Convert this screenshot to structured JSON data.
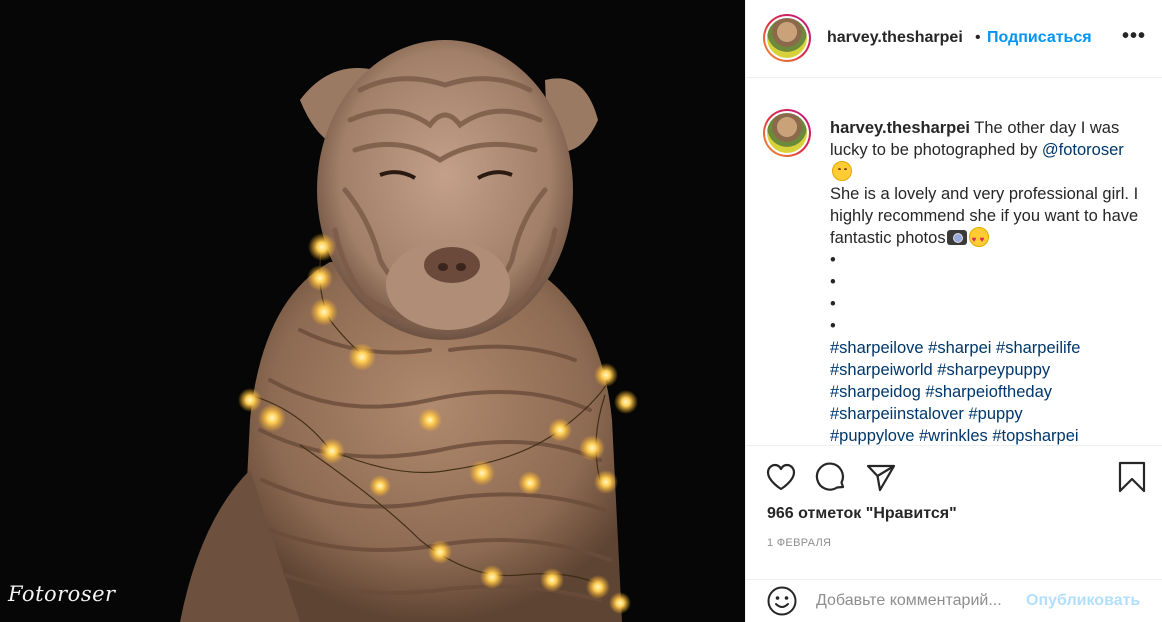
{
  "photo": {
    "watermark": "Fotoroser",
    "alt": "Shar pei dog with fairy lights"
  },
  "header": {
    "username": "harvey.thesharpei",
    "separator": "•",
    "follow_label": "Подписаться",
    "more_label": "•••"
  },
  "caption": {
    "username": "harvey.thesharpei",
    "text_1": " The other day I was lucky to be photographed by ",
    "mention": "@fotoroser",
    "text_2": "She is a lovely and very professional girl. I highly recommend she if you want to have fantastic photos",
    "bullets": [
      "•",
      "•",
      "•",
      "•"
    ],
    "hashtags_1": "#sharpeilove #sharpei #sharpeilife",
    "hashtags_2": "#sharpeiworld #sharpeypuppy",
    "hashtags_3": "#sharpeidog #sharpeioftheday",
    "hashtags_4": "#sharpeiinstalover #puppy",
    "hashtags_5": "#puppylove #wrinkles #topsharpei"
  },
  "actions": {
    "icons": [
      "heart-icon",
      "comment-icon",
      "share-icon",
      "bookmark-icon"
    ],
    "likes": "966 отметок \"Нравится\"",
    "date": "1 ФЕВРАЛЯ"
  },
  "comment_box": {
    "placeholder": "Добавьте комментарий...",
    "publish_label": "Опубликовать"
  },
  "colors": {
    "link_blue": "#0095f6",
    "hashtag_blue": "#00376b",
    "publish_disabled": "#b2dffc"
  }
}
